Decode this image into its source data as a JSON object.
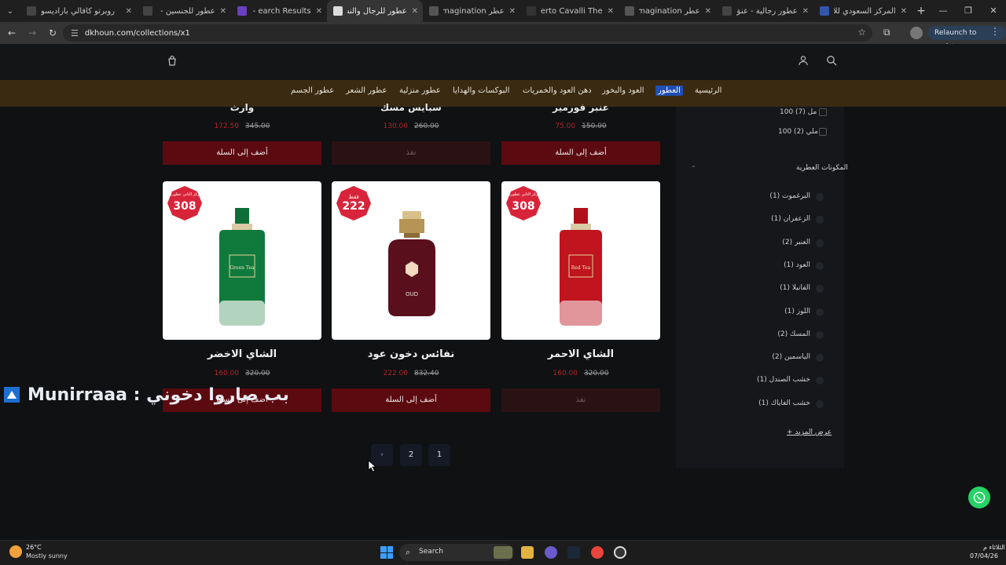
{
  "browser": {
    "tabs": [
      {
        "title": "روبرتو كافالي باراديسو",
        "color": "#444444"
      },
      {
        "title": "عطور للجنسين - عنق",
        "color": "#444444"
      },
      {
        "title": "earch Results - دخون",
        "color": "#6a3fc0"
      },
      {
        "title": "عطور للرجال والنساء",
        "color": "#dddddd"
      },
      {
        "title": "عطر Imagination -",
        "color": "#555555"
      },
      {
        "title": "Roberto Cavalli The",
        "color": "#333333"
      },
      {
        "title": "عطر Imagination -",
        "color": "#555555"
      },
      {
        "title": "عطور رجالية - عنق",
        "color": "#444444"
      },
      {
        "title": "المركز السعودي للأعـ",
        "color": "#3355aa"
      }
    ],
    "url": "dkhoun.com/collections/x1",
    "relaunch_label": "Relaunch to update"
  },
  "nav": {
    "items": [
      "الرئيسية",
      "العطور",
      "العود والبخور",
      "دهن العود والخمريات",
      "البوكسات والهدايا",
      "عطور منزلية",
      "عطور الشعر",
      "عطور الجسم"
    ],
    "active": "العطور"
  },
  "prev_row": [
    {
      "name": "عنبر فورمير",
      "sale": "75.00",
      "old": "150.00",
      "button": "أضف إلى السلة"
    },
    {
      "name": "سبايس مسك",
      "sale": "130.00",
      "old": "260.00",
      "button": "نفذ"
    },
    {
      "name": "وارث",
      "sale": "172.50",
      "old": "345.00",
      "button": "أضف إلى السلة"
    }
  ],
  "products": [
    {
      "name": "الشاي الاحمر",
      "sale": "160.00",
      "old": "320.00",
      "button": "نفذ",
      "badge_top": "مركز الثاني عطورين",
      "badge_num": "308",
      "bottle_color": "#c0141e",
      "bottle_label": "Red Tea"
    },
    {
      "name": "نفائس دخون عود",
      "sale": "222.00",
      "old": "832.40",
      "button": "أضف إلى السلة",
      "badge_top": "فقط",
      "badge_num": "222",
      "bottle_color": "#5a0f1c",
      "bottle_label": "OUD"
    },
    {
      "name": "الشاي الاخضر",
      "sale": "160.00",
      "old": "320.00",
      "button": "أضف إلى السلة",
      "badge_top": "مركز الثاني عطورين",
      "badge_num": "308",
      "bottle_color": "#0f7a3c",
      "bottle_label": "Green Tea"
    }
  ],
  "pagination": {
    "pages": [
      "1",
      "2"
    ],
    "next": "›"
  },
  "overlay_text": "Munirraaa : بب صاروا دخوني",
  "sidebar": {
    "sizes": [
      "100 مل (7)",
      "100 ملي (2)"
    ],
    "section_title": "المكونات العطرية",
    "ingredients": [
      "البرغموت (1)",
      "الزعفران (1)",
      "العنبر (2)",
      "العود (1)",
      "الفانيلا (1)",
      "اللوز (1)",
      "المسك (2)",
      "الياسمين (2)",
      "خشب الصندل (1)",
      "خشب الغاياك (1)"
    ],
    "more": "+ عرض المزيد"
  },
  "taskbar": {
    "temp": "26°C",
    "weather": "Mostly sunny",
    "search": "Search",
    "time": "الثلاثاء م",
    "date": "07/04/26"
  }
}
